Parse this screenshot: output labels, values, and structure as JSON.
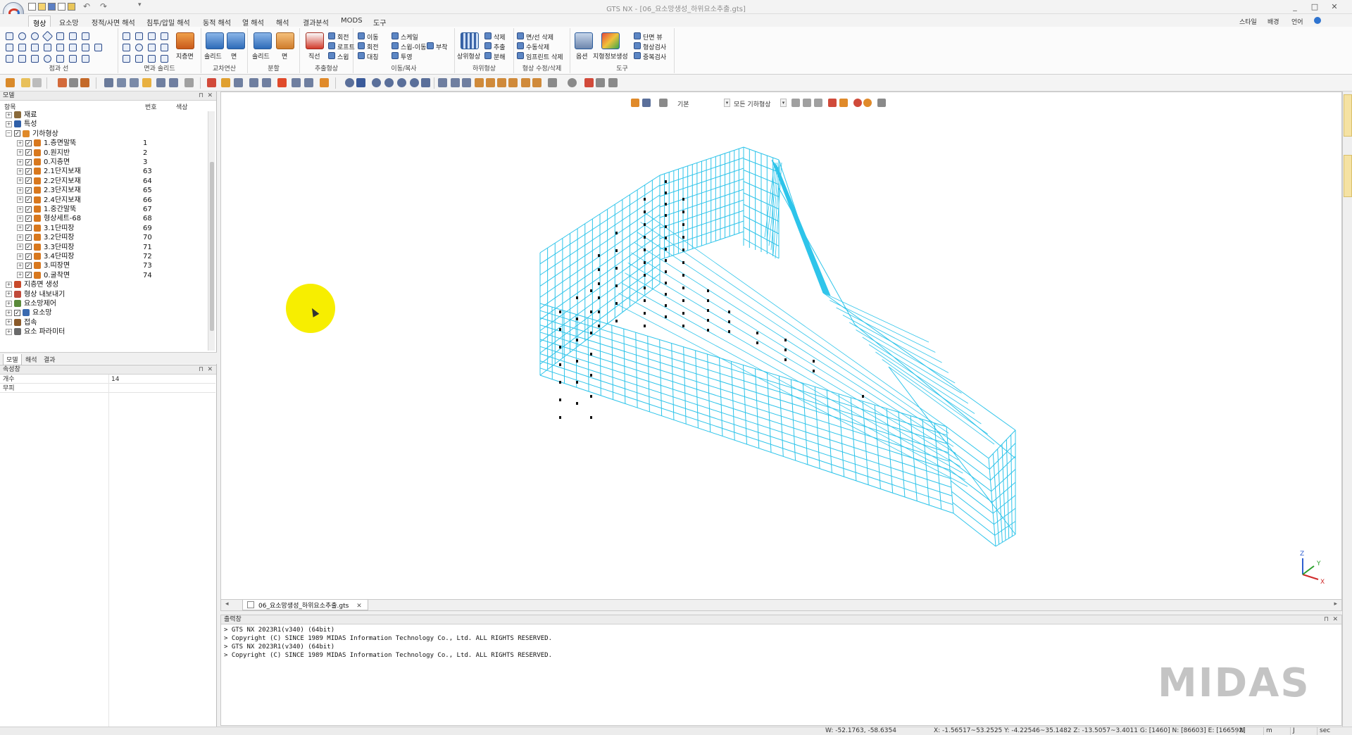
{
  "window": {
    "title": "GTS NX - [06_요소망생성_하위요소추출.gts]",
    "controls": [
      "_",
      "□",
      "✕"
    ]
  },
  "menu": {
    "tabs": [
      "형상",
      "요소망",
      "정적/사면 해석",
      "침투/압밀 해석",
      "동적 해석",
      "열 해석",
      "해석",
      "결과분석",
      "MODS",
      "도구"
    ],
    "right_items": [
      "스타일",
      "배경",
      "언어"
    ]
  },
  "ribbon": {
    "groups": [
      "점과 선",
      "면과 솔리드",
      "교차연산",
      "분할",
      "추출형상",
      "이동/복사",
      "하위형상",
      "형상 수정/삭제",
      "도구"
    ],
    "buttons": {
      "jipyomyeon": "지층면",
      "solid1": "솔리드",
      "myeon1": "면",
      "solid2": "솔리드",
      "myeon2": "면",
      "jikseon": "직선",
      "hoejeon": "회전",
      "loft": "로프트",
      "sweep": "스윕",
      "idong": "이동",
      "scale": "스케일",
      "hoejeon2": "회전",
      "sweep_idong": "스윕-이동",
      "buchak": "부착",
      "daechinq": "대칭",
      "tuyeong": "투영",
      "sangwi": "상위형상",
      "sakje": "삭제",
      "chuchul": "추출",
      "bunhae": "분해",
      "myeonseon": "면/선 삭제",
      "susang": "수동삭제",
      "imprint": "임프린트 삭제",
      "option": "옵션",
      "jicheung": "지형정보생성",
      "danmyeon": "단면 뷰",
      "hyeongsang": "형상검사",
      "jungbok": "중복검사"
    }
  },
  "model_panel": {
    "title": "모델",
    "col_headers": {
      "item": "항목",
      "num": "번호",
      "color": "색상"
    },
    "tree": [
      {
        "label": "재료",
        "level": 0,
        "num": "",
        "checked": null,
        "icon": "material-icon"
      },
      {
        "label": "특성",
        "level": 0,
        "num": "",
        "checked": null,
        "icon": "property-icon"
      },
      {
        "label": "기하형상",
        "level": 0,
        "num": "",
        "checked": true,
        "icon": "geometry-icon"
      },
      {
        "label": "1.층면말뚝",
        "level": 1,
        "num": "1",
        "checked": true,
        "icon": "solid-icon"
      },
      {
        "label": "0.원지반",
        "level": 1,
        "num": "2",
        "checked": true,
        "icon": "solid-icon"
      },
      {
        "label": "0.지층면",
        "level": 1,
        "num": "3",
        "checked": true,
        "icon": "solid-icon"
      },
      {
        "label": "2.1단지보재",
        "level": 1,
        "num": "63",
        "checked": true,
        "icon": "solid-icon"
      },
      {
        "label": "2.2단지보재",
        "level": 1,
        "num": "64",
        "checked": true,
        "icon": "solid-icon"
      },
      {
        "label": "2.3단지보재",
        "level": 1,
        "num": "65",
        "checked": true,
        "icon": "solid-icon"
      },
      {
        "label": "2.4단지보재",
        "level": 1,
        "num": "66",
        "checked": true,
        "icon": "solid-icon"
      },
      {
        "label": "1.중간말뚝",
        "level": 1,
        "num": "67",
        "checked": true,
        "icon": "solid-icon"
      },
      {
        "label": "형상세트-68",
        "level": 1,
        "num": "68",
        "checked": true,
        "icon": "solid-icon"
      },
      {
        "label": "3.1단띠장",
        "level": 1,
        "num": "69",
        "checked": true,
        "icon": "solid-icon"
      },
      {
        "label": "3.2단띠장",
        "level": 1,
        "num": "70",
        "checked": true,
        "icon": "solid-icon"
      },
      {
        "label": "3.3단띠장",
        "level": 1,
        "num": "71",
        "checked": true,
        "icon": "solid-icon"
      },
      {
        "label": "3.4단띠장",
        "level": 1,
        "num": "72",
        "checked": true,
        "icon": "solid-icon"
      },
      {
        "label": "3.띠장면",
        "level": 1,
        "num": "73",
        "checked": true,
        "icon": "solid-icon"
      },
      {
        "label": "0.굴착면",
        "level": 1,
        "num": "74",
        "checked": true,
        "icon": "solid-icon"
      },
      {
        "label": "지층면 생성",
        "level": 0,
        "num": "",
        "checked": null,
        "icon": "layer-icon"
      },
      {
        "label": "형상 내보내기",
        "level": 0,
        "num": "",
        "checked": null,
        "icon": "export-icon"
      },
      {
        "label": "요소망제어",
        "level": 0,
        "num": "",
        "checked": null,
        "icon": "mesh-control-icon"
      },
      {
        "label": "요소망",
        "level": 0,
        "num": "",
        "checked": true,
        "icon": "mesh-icon"
      },
      {
        "label": "접속",
        "level": 0,
        "num": "",
        "checked": null,
        "icon": "connection-icon"
      },
      {
        "label": "요소 파라미터",
        "level": 0,
        "num": "",
        "checked": null,
        "icon": "parameter-icon"
      }
    ],
    "tabs": [
      "모델",
      "해석",
      "결과"
    ]
  },
  "props_panel": {
    "title": "속성창",
    "rows": [
      {
        "key": "개수",
        "value": "14"
      },
      {
        "key": "무피",
        "value": ""
      }
    ]
  },
  "view_toolbar": {
    "display_label": "기본",
    "shape_label": "모든 기하형상"
  },
  "document_tab": {
    "label": "06_요소망생성_하위요소추출.gts"
  },
  "output_panel": {
    "title": "출력창",
    "lines": [
      "> GTS NX 2023R1(v340) (64bit)",
      "> Copyright (C) SINCE 1989 MIDAS Information Technology Co., Ltd. ALL RIGHTS RESERVED.",
      "> GTS NX 2023R1(v340) (64bit)",
      "> Copyright (C) SINCE 1989 MIDAS Information Technology Co., Ltd. ALL RIGHTS RESERVED."
    ],
    "watermark": "MIDAS"
  },
  "axis_triad": {
    "z": "Z",
    "y": "Y",
    "x": "X"
  },
  "statusbar": {
    "window_coords": "W: -52.1763, -58.6354",
    "model_coords": "X: -1.56517~53.2525 Y: -4.22546~35.1482 Z: -13.5057~3.4011 G: [1460] N: [86603] E: [166592]",
    "units": [
      "N",
      "m",
      "J",
      "sec"
    ]
  },
  "colors": {
    "mesh": "#2ec4ea",
    "node": "#111111",
    "cursor_highlight": "#f7ee00"
  }
}
